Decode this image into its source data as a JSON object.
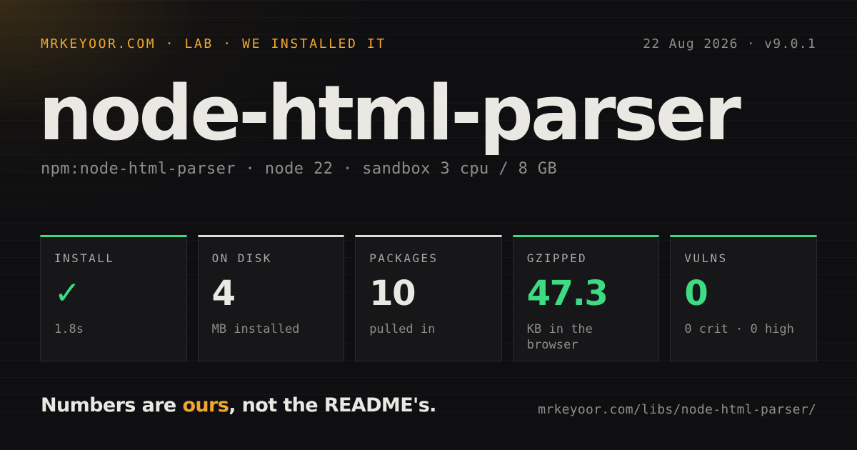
{
  "header": {
    "kicker": "MRKEYOOR.COM · LAB · WE INSTALLED IT",
    "meta": "22 Aug 2026 · v9.0.1"
  },
  "title": "node-html-parser",
  "subtitle": "npm:node-html-parser · node 22 · sandbox 3 cpu / 8 GB",
  "cards": [
    {
      "label": "INSTALL",
      "value": "✓",
      "note": "1.8s",
      "accent": "#3ddc84",
      "value_color": "#3ddc84"
    },
    {
      "label": "ON DISK",
      "value": "4",
      "note": "MB installed",
      "accent": "#dedcd6",
      "value_color": "#eae8e2"
    },
    {
      "label": "PACKAGES",
      "value": "10",
      "note": "pulled in",
      "accent": "#dedcd6",
      "value_color": "#eae8e2"
    },
    {
      "label": "GZIPPED",
      "value": "47.3",
      "note": "KB in the browser",
      "accent": "#3ddc84",
      "value_color": "#3ddc84"
    },
    {
      "label": "VULNS",
      "value": "0",
      "note": "0 crit · 0 high",
      "accent": "#3ddc84",
      "value_color": "#3ddc84"
    }
  ],
  "footer": {
    "tagline_before": "Numbers are ",
    "tagline_highlight": "ours",
    "tagline_after": ", not the README's.",
    "url": "mrkeyoor.com/libs/node-html-parser/"
  },
  "colors": {
    "background": "#0f0f11",
    "accent_orange": "#f0a72e",
    "accent_green": "#3ddc84",
    "text_primary": "#eae8e2",
    "text_muted": "#8f8d89"
  }
}
